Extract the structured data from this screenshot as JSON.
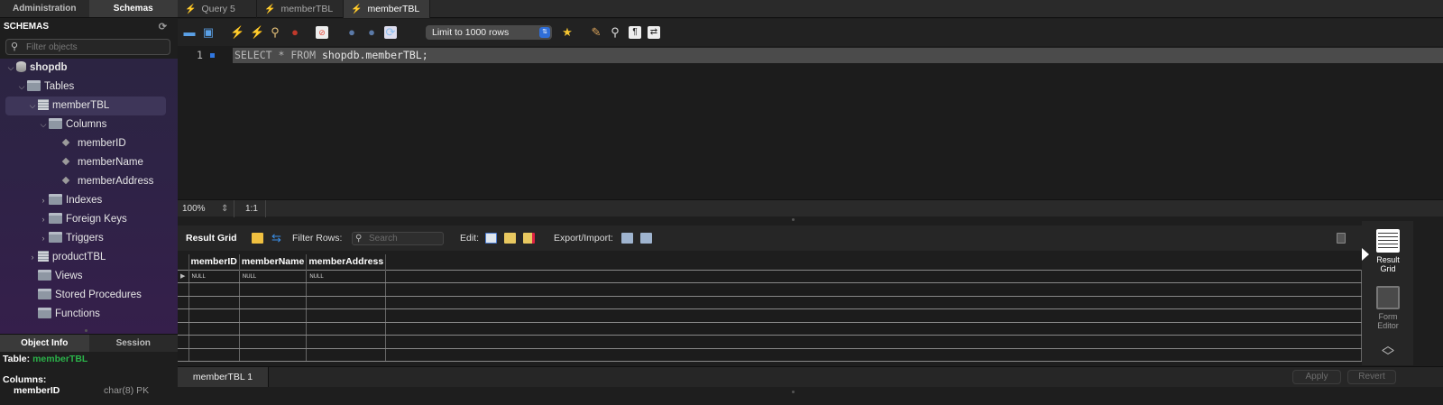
{
  "sidebar": {
    "tabs": [
      "Administration",
      "Schemas"
    ],
    "active_tab": "Schemas",
    "header": "SCHEMAS",
    "filter_placeholder": "Filter objects",
    "tree": {
      "schema": "shopdb",
      "tables_label": "Tables",
      "selected_table": "memberTBL",
      "columns_label": "Columns",
      "columns": [
        "memberID",
        "memberName",
        "memberAddress"
      ],
      "indexes_label": "Indexes",
      "foreign_keys_label": "Foreign Keys",
      "triggers_label": "Triggers",
      "other_table": "productTBL",
      "views_label": "Views",
      "procedures_label": "Stored Procedures",
      "functions_label": "Functions"
    },
    "bottom_tabs": [
      "Object Info",
      "Session"
    ],
    "object_info": {
      "table_label": "Table:",
      "table_name": "memberTBL",
      "columns_label": "Columns:",
      "first_column": "memberID",
      "first_column_type": "char(8) PK"
    }
  },
  "editor_tabs": [
    {
      "label": "Query 5",
      "active": false
    },
    {
      "label": "memberTBL",
      "active": false
    },
    {
      "label": "memberTBL",
      "active": true
    }
  ],
  "toolbar": {
    "limit_select": "Limit to 1000 rows"
  },
  "editor": {
    "line_number": "1",
    "sql": {
      "kw1": "SELECT",
      "star": " * ",
      "kw2": "FROM",
      "rest": " shopdb.memberTBL;"
    },
    "zoom": "100%",
    "position": "1:1"
  },
  "result": {
    "grid_label": "Result Grid",
    "filter_rows_label": "Filter Rows:",
    "search_placeholder": "Search",
    "edit_label": "Edit:",
    "export_label": "Export/Import:",
    "columns": [
      "memberID",
      "memberName",
      "memberAddress"
    ],
    "first_row": [
      "NULL",
      "NULL",
      "NULL"
    ],
    "empty_rows": 6,
    "side_buttons": {
      "result_grid_1": "Result",
      "result_grid_2": "Grid",
      "form_editor_1": "Form",
      "form_editor_2": "Editor"
    },
    "result_tab": "memberTBL 1",
    "apply_label": "Apply",
    "revert_label": "Revert"
  }
}
